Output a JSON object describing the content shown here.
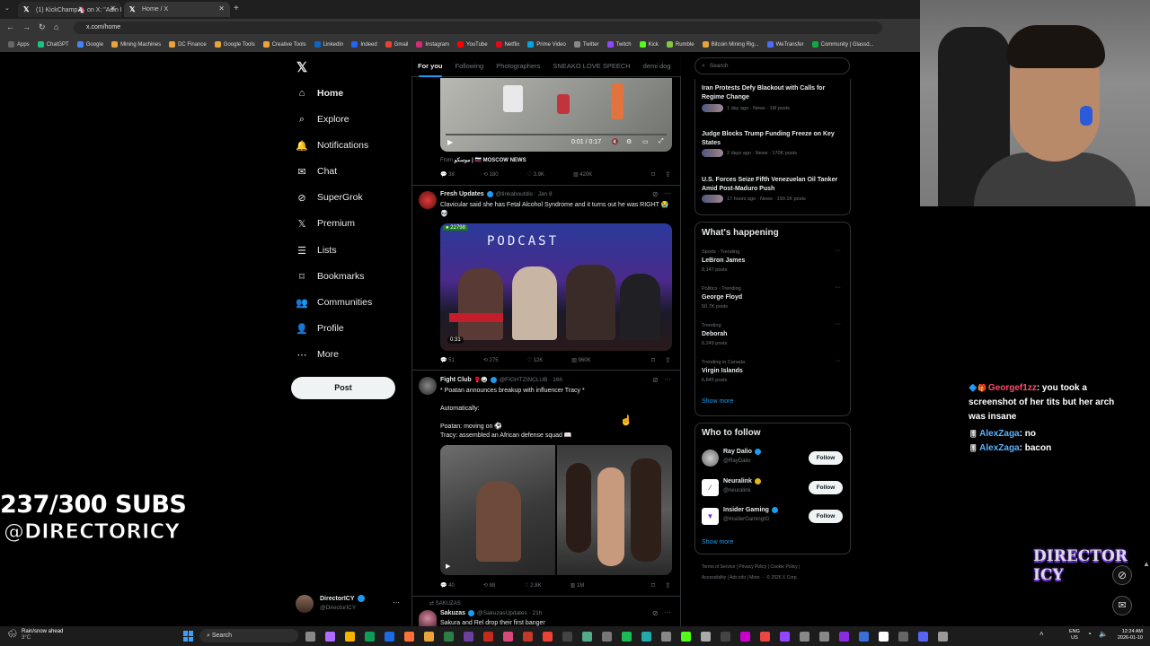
{
  "browser": {
    "tabs": [
      {
        "title": "(1) KickChamp🦄 on X: \"Adin R",
        "active": false
      },
      {
        "title": "Home / X",
        "active": true
      }
    ],
    "url": "x.com/home",
    "bookmarks": [
      "Apps",
      "ChatGPT",
      "Google",
      "Mining Machines",
      "DC Finance",
      "Google Tools",
      "Creative Tools",
      "LinkedIn",
      "Indeed",
      "Gmail",
      "Instagram",
      "YouTube",
      "Netflix",
      "Prime Video",
      "Twitter",
      "Twitch",
      "Kick",
      "Rumble",
      "Bitcoin Mining Rig...",
      "WeTransfer",
      "Community | Glassd..."
    ]
  },
  "nav": {
    "items": [
      "Home",
      "Explore",
      "Notifications",
      "Chat",
      "SuperGrok",
      "Premium",
      "Lists",
      "Bookmarks",
      "Communities",
      "Profile",
      "More"
    ],
    "post_label": "Post",
    "account_name": "DirectorICY",
    "account_handle": "@DirectorICY"
  },
  "feed": {
    "tabs": [
      "For you",
      "Following",
      "Photographers",
      "SNEAKO LOVE SPEECH",
      "demi dog"
    ],
    "video_time": "0:01 / 0:17",
    "from_line": "From",
    "from_source": "موسكو | 🇷🇺 MOSCOW NEWS",
    "post0_stats": [
      "38",
      "180",
      "3.9K",
      "420K"
    ],
    "post1": {
      "name": "Fresh Updates",
      "handle": "@tinkaboutdis · Jan 8",
      "text": "Clavicular said she has Fetal Alcohol Syndrome and it turns out he was RIGHT 😭💀",
      "viewers": "22798",
      "podcast": "PODCAST",
      "duration": "0:31",
      "stats": [
        "51",
        "275",
        "12K",
        "960K"
      ]
    },
    "post2": {
      "name": "Fight Club",
      "handle": "@FIGHTZINCLUB · 16h",
      "line1": "* Poatan announces breakup with influencer Tracy *",
      "line2": "Automatically:",
      "line3": "Poatan: moving on ⚽",
      "line4": "Tracy: assembled an African defense squad 📖",
      "stats": [
        "40",
        "88",
        "2.8K",
        "1M"
      ]
    },
    "post3": {
      "context": "SAKUZAS",
      "name": "Sakuzas",
      "handle": "@SakuzasUpdates · 21h",
      "text": "Sakura and Rel drop their first banger"
    }
  },
  "right": {
    "search_placeholder": "Search",
    "news": [
      {
        "title": "Iran Protests Defy Blackout with Calls for Regime Change",
        "meta": "1 day ago · News · 1M posts"
      },
      {
        "title": "Judge Blocks Trump Funding Freeze on Key States",
        "meta": "2 days ago · News · 170K posts"
      },
      {
        "title": "U.S. Forces Seize Fifth Venezuelan Oil Tanker Amid Post-Maduro Push",
        "meta": "17 hours ago · News · 190.1K posts"
      }
    ],
    "happening_title": "What's happening",
    "trends": [
      {
        "context": "Sports · Trending",
        "name": "LeBron James",
        "posts": "8,147 posts"
      },
      {
        "context": "Politics · Trending",
        "name": "George Floyd",
        "posts": "50.7K posts"
      },
      {
        "context": "Trending",
        "name": "Deborah",
        "posts": "6,249 posts"
      },
      {
        "context": "Trending in Canada",
        "name": "Virgin Islands",
        "posts": "6,845 posts"
      }
    ],
    "show_more": "Show more",
    "follow_title": "Who to follow",
    "follow": [
      {
        "name": "Ray Dalio",
        "handle": "@RayDalio",
        "btn": "Follow"
      },
      {
        "name": "Neuralink",
        "handle": "@neuralink",
        "btn": "Follow"
      },
      {
        "name": "Insider Gaming",
        "handle": "@InsiderGamingIG",
        "btn": "Follow"
      }
    ],
    "footer1": "Terms of Service | Privacy Policy | Cookie Policy |",
    "footer2": "Accessibility | Ads info | More ··· © 2026 X Corp."
  },
  "overlay": {
    "subs": "237/300 SUBS",
    "handle": "@DIRECTORICY",
    "logo_text": "DIRECTOR ICY",
    "chat": [
      {
        "user": "Georgef1zz",
        "msg": ": you took a screenshot of her tits but her arch was insane"
      },
      {
        "user": "AlexZaga",
        "msg": ": no"
      },
      {
        "user": "AlexZaga",
        "msg": ": bacon"
      }
    ]
  },
  "taskbar": {
    "weather": "Rain/snow ahead",
    "temp": "3°C",
    "search": "Search",
    "lang1": "ENG",
    "lang2": "US",
    "time": "12:24 AM",
    "date": "2026-01-10"
  },
  "colors": {
    "accent": "#1d9bf0",
    "verified": "#1d9bf0",
    "gold": "#e2b719",
    "chat_user_red": "#ff4d6a",
    "chat_user_blue": "#5ab4ff"
  }
}
